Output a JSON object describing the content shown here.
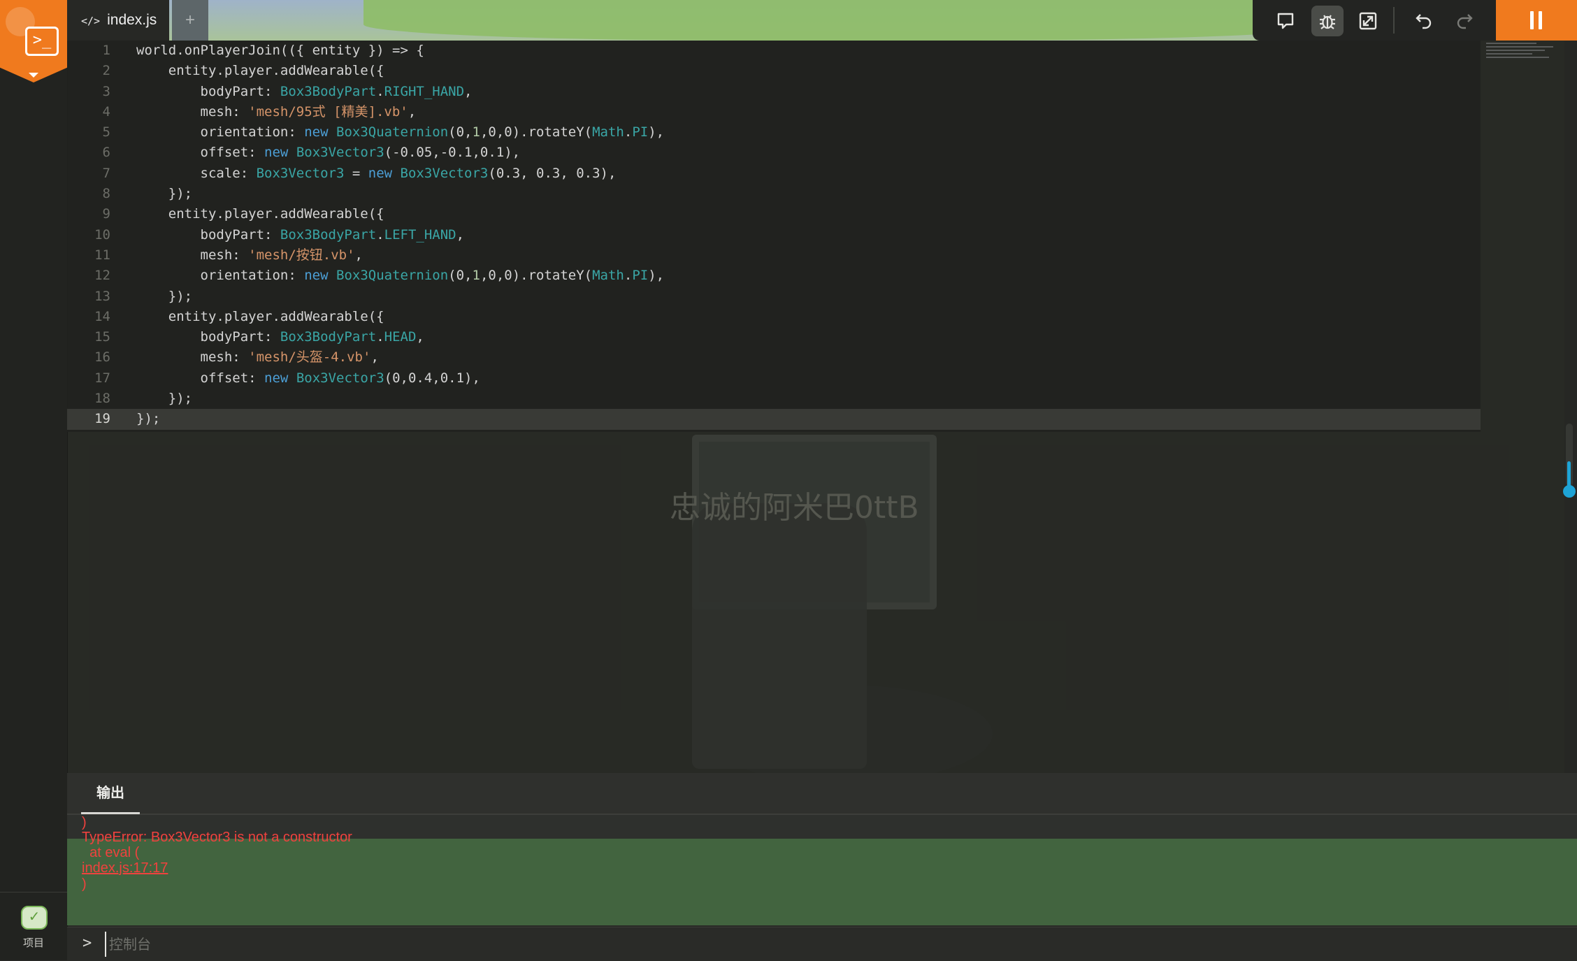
{
  "tabs": {
    "active_file": "index.js",
    "add_label": "+"
  },
  "sidebar": {
    "project_label": "项目"
  },
  "scene": {
    "player_name": "忠诚的阿米巴0ttB"
  },
  "editor": {
    "current_line": 19,
    "lines": [
      [
        {
          "t": "world.onPlayerJoin(({ entity }) => {",
          "c": ""
        }
      ],
      [
        {
          "t": "    entity.player.addWearable({",
          "c": ""
        }
      ],
      [
        {
          "t": "        bodyPart: ",
          "c": ""
        },
        {
          "t": "Box3BodyPart",
          "c": "t"
        },
        {
          "t": ".",
          "c": ""
        },
        {
          "t": "RIGHT_HAND",
          "c": "t"
        },
        {
          "t": ",",
          "c": ""
        }
      ],
      [
        {
          "t": "        mesh: ",
          "c": ""
        },
        {
          "t": "'mesh/95式 [精美].vb'",
          "c": "s"
        },
        {
          "t": ",",
          "c": ""
        }
      ],
      [
        {
          "t": "        orientation: ",
          "c": ""
        },
        {
          "t": "new",
          "c": "k"
        },
        {
          "t": " ",
          "c": ""
        },
        {
          "t": "Box3Quaternion",
          "c": "t"
        },
        {
          "t": "(0,",
          "c": ""
        },
        {
          "t": "1",
          "c": "n"
        },
        {
          "t": ",0,0).rotateY(",
          "c": ""
        },
        {
          "t": "Math",
          "c": "t"
        },
        {
          "t": ".",
          "c": ""
        },
        {
          "t": "PI",
          "c": "t"
        },
        {
          "t": "),",
          "c": ""
        }
      ],
      [
        {
          "t": "        offset: ",
          "c": ""
        },
        {
          "t": "new",
          "c": "k"
        },
        {
          "t": " ",
          "c": ""
        },
        {
          "t": "Box3Vector3",
          "c": "t"
        },
        {
          "t": "(-0.05,-0.1,0.1),",
          "c": ""
        }
      ],
      [
        {
          "t": "        scale: ",
          "c": ""
        },
        {
          "t": "Box3Vector3",
          "c": "t"
        },
        {
          "t": " = ",
          "c": ""
        },
        {
          "t": "new",
          "c": "k"
        },
        {
          "t": " ",
          "c": ""
        },
        {
          "t": "Box3Vector3",
          "c": "t"
        },
        {
          "t": "(0.3, 0.3, 0.3),",
          "c": ""
        }
      ],
      [
        {
          "t": "    });",
          "c": ""
        }
      ],
      [
        {
          "t": "    entity.player.addWearable({",
          "c": ""
        }
      ],
      [
        {
          "t": "        bodyPart: ",
          "c": ""
        },
        {
          "t": "Box3BodyPart",
          "c": "t"
        },
        {
          "t": ".",
          "c": ""
        },
        {
          "t": "LEFT_HAND",
          "c": "t"
        },
        {
          "t": ",",
          "c": ""
        }
      ],
      [
        {
          "t": "        mesh: ",
          "c": ""
        },
        {
          "t": "'mesh/按钮.vb'",
          "c": "s"
        },
        {
          "t": ",",
          "c": ""
        }
      ],
      [
        {
          "t": "        orientation: ",
          "c": ""
        },
        {
          "t": "new",
          "c": "k"
        },
        {
          "t": " ",
          "c": ""
        },
        {
          "t": "Box3Quaternion",
          "c": "t"
        },
        {
          "t": "(0,",
          "c": ""
        },
        {
          "t": "1",
          "c": "n"
        },
        {
          "t": ",0,0).rotateY(",
          "c": ""
        },
        {
          "t": "Math",
          "c": "t"
        },
        {
          "t": ".",
          "c": ""
        },
        {
          "t": "PI",
          "c": "t"
        },
        {
          "t": "),",
          "c": ""
        }
      ],
      [
        {
          "t": "    });",
          "c": ""
        }
      ],
      [
        {
          "t": "    entity.player.addWearable({",
          "c": ""
        }
      ],
      [
        {
          "t": "        bodyPart: ",
          "c": ""
        },
        {
          "t": "Box3BodyPart",
          "c": "t"
        },
        {
          "t": ".",
          "c": ""
        },
        {
          "t": "HEAD",
          "c": "t"
        },
        {
          "t": ",",
          "c": ""
        }
      ],
      [
        {
          "t": "        mesh: ",
          "c": ""
        },
        {
          "t": "'mesh/头盔-4.vb'",
          "c": "s"
        },
        {
          "t": ",",
          "c": ""
        }
      ],
      [
        {
          "t": "        offset: ",
          "c": ""
        },
        {
          "t": "new",
          "c": "k"
        },
        {
          "t": " ",
          "c": ""
        },
        {
          "t": "Box3Vector3",
          "c": "t"
        },
        {
          "t": "(0,0.4,0.1),",
          "c": ""
        }
      ],
      [
        {
          "t": "    });",
          "c": ""
        }
      ],
      [
        {
          "t": "});",
          "c": ""
        }
      ]
    ]
  },
  "output": {
    "tab_label": "输出",
    "lines": [
      {
        "text": ")",
        "link": false
      },
      {
        "text": "TypeError: Box3Vector3 is not a constructor",
        "link": false
      },
      {
        "text": "  at eval (",
        "link": false
      },
      {
        "text": "index.js:17:17",
        "link": true
      },
      {
        "text": ")",
        "link": false
      }
    ]
  },
  "console": {
    "placeholder": "控制台",
    "prompt": ">"
  },
  "toolbar": {
    "buttons": [
      {
        "name": "chat",
        "icon": "chat-bubble-icon",
        "active": false
      },
      {
        "name": "debug",
        "icon": "bug-icon",
        "active": true
      },
      {
        "name": "fullscreen",
        "icon": "expand-arrows-icon",
        "active": false
      },
      {
        "name": "undo",
        "icon": "undo-icon",
        "active": false
      },
      {
        "name": "redo",
        "icon": "redo-icon",
        "active": false
      }
    ],
    "pause_icon": "pause-icon"
  },
  "colors": {
    "accent": "#f07a1e",
    "error": "#f0423e",
    "output_highlight": "#42643f",
    "type": "#3aa6a6",
    "keyword": "#4c9fd6",
    "string": "#d59469",
    "scrollbar": "#1ea4d6"
  }
}
